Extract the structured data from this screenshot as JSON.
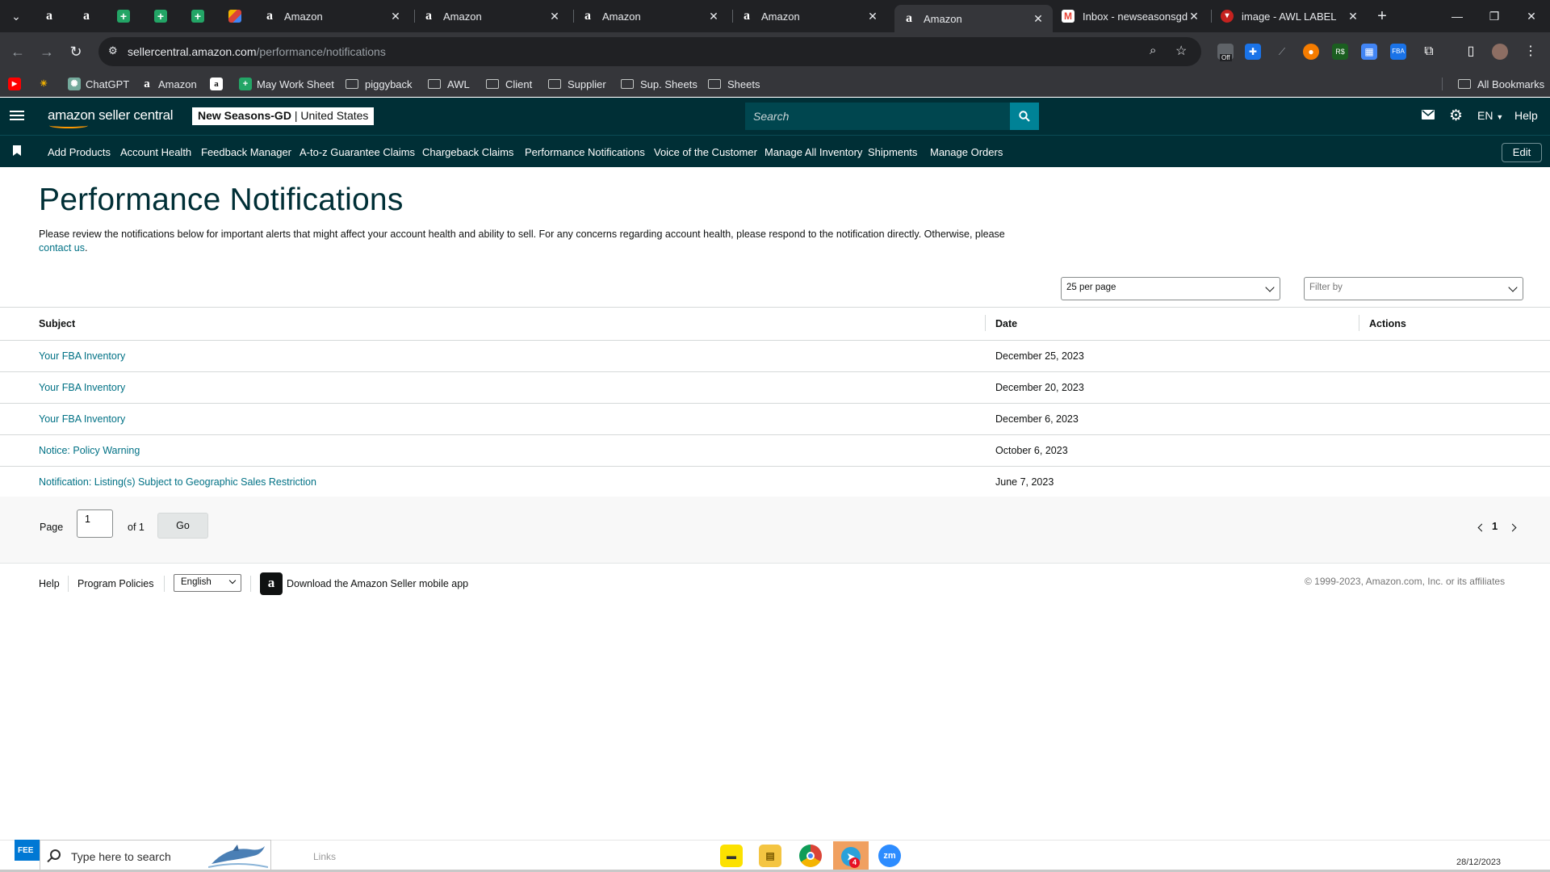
{
  "browser": {
    "tabs": [
      {
        "title": "Amazon",
        "favicon": "amazon-icon",
        "active": false
      },
      {
        "title": "Amazon",
        "favicon": "amazon-icon",
        "active": false
      },
      {
        "title": "Amazon",
        "favicon": "amazon-icon",
        "active": false
      },
      {
        "title": "Amazon",
        "favicon": "amazon-icon",
        "active": false
      },
      {
        "title": "Amazon",
        "favicon": "amazon-icon",
        "active": true
      },
      {
        "title": "Inbox - newseasonsgd@",
        "favicon": "gmail-icon",
        "active": false
      },
      {
        "title": "image - AWL LABEL",
        "favicon": "awl-icon",
        "active": false
      }
    ],
    "url_host": "sellercentral.amazon.com",
    "url_path": "/performance/notifications",
    "bookmarks": [
      {
        "label": "ChatGPT",
        "icon": "chatgpt-icon"
      },
      {
        "label": "Amazon",
        "icon": "amazon-icon"
      },
      {
        "label": "May Work Sheet",
        "icon": "sheets-icon"
      },
      {
        "label": "piggyback",
        "icon": "folder-icon"
      },
      {
        "label": "AWL",
        "icon": "folder-icon"
      },
      {
        "label": "Client",
        "icon": "folder-icon"
      },
      {
        "label": "Supplier",
        "icon": "folder-icon"
      },
      {
        "label": "Sup. Sheets",
        "icon": "folder-icon"
      },
      {
        "label": "Sheets",
        "icon": "folder-icon"
      }
    ],
    "all_bookmarks": "All Bookmarks",
    "extension_badge": "Off"
  },
  "header": {
    "logo": "amazon seller central",
    "account_name": "New Seasons-GD",
    "account_region": "| United States",
    "search_placeholder": "Search",
    "language": "EN",
    "help": "Help"
  },
  "nav": {
    "links": [
      "Add Products",
      "Account Health",
      "Feedback Manager",
      "A-to-z Guarantee Claims",
      "Chargeback Claims",
      "Performance Notifications",
      "Voice of the Customer",
      "Manage All Inventory",
      "Shipments",
      "Manage Orders"
    ],
    "edit": "Edit"
  },
  "page": {
    "title": "Performance Notifications",
    "description": "Please review the notifications below for important alerts that might affect your account health and ability to sell. For any concerns regarding account health, please respond to the notification directly. Otherwise, please",
    "contact_link": "contact us",
    "per_page": "25 per page",
    "filter_placeholder": "Filter by"
  },
  "table": {
    "columns": [
      "Subject",
      "Date",
      "Actions"
    ],
    "rows": [
      {
        "subject": "Your FBA Inventory",
        "date": "December 25, 2023"
      },
      {
        "subject": "Your FBA Inventory",
        "date": "December 20, 2023"
      },
      {
        "subject": "Your FBA Inventory",
        "date": "December 6, 2023"
      },
      {
        "subject": "Notice: Policy Warning",
        "date": "October 6, 2023"
      },
      {
        "subject": "Notification: Listing(s) Subject to Geographic Sales Restriction",
        "date": "June 7, 2023"
      }
    ]
  },
  "pagination": {
    "page_label": "Page",
    "page_value": "1",
    "of_label": "of 1",
    "go": "Go",
    "current": "1"
  },
  "footer": {
    "help": "Help",
    "program_policies": "Program Policies",
    "language": "English",
    "app_download": "Download the Amazon Seller mobile app",
    "copyright": "© 1999-2023, Amazon.com, Inc. or its affiliates"
  },
  "taskbar": {
    "start_label": "FEE",
    "search_placeholder": "Type here to search",
    "links": "Links",
    "telegram_badge": "4",
    "date": "28/12/2023"
  },
  "colors": {
    "header_bg": "#002f36",
    "link": "#007185",
    "search_button": "#008296"
  }
}
